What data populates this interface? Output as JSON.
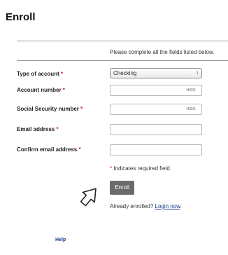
{
  "page": {
    "title": "Enroll",
    "instructions": "Please complete all the fields listed below."
  },
  "form": {
    "account_type": {
      "label": "Type of account",
      "value": "Checking"
    },
    "account_number": {
      "label": "Account number",
      "value": "",
      "toggle": "HIDE"
    },
    "ssn": {
      "label": "Social Security number",
      "value": "",
      "toggle": "HIDE"
    },
    "email": {
      "label": "Email address",
      "value": ""
    },
    "confirm_email": {
      "label": "Confirm email address",
      "value": ""
    },
    "required_marker": "*",
    "required_note": "Indicates required field",
    "submit_label": "Enroll",
    "already_text": "Already enrolled?",
    "login_link": "Login now",
    "login_suffix": "."
  },
  "footer": {
    "help": "Help"
  },
  "colors": {
    "required": "#d0191b",
    "button": "#6b6b6b",
    "link": "#1a3a8c"
  }
}
